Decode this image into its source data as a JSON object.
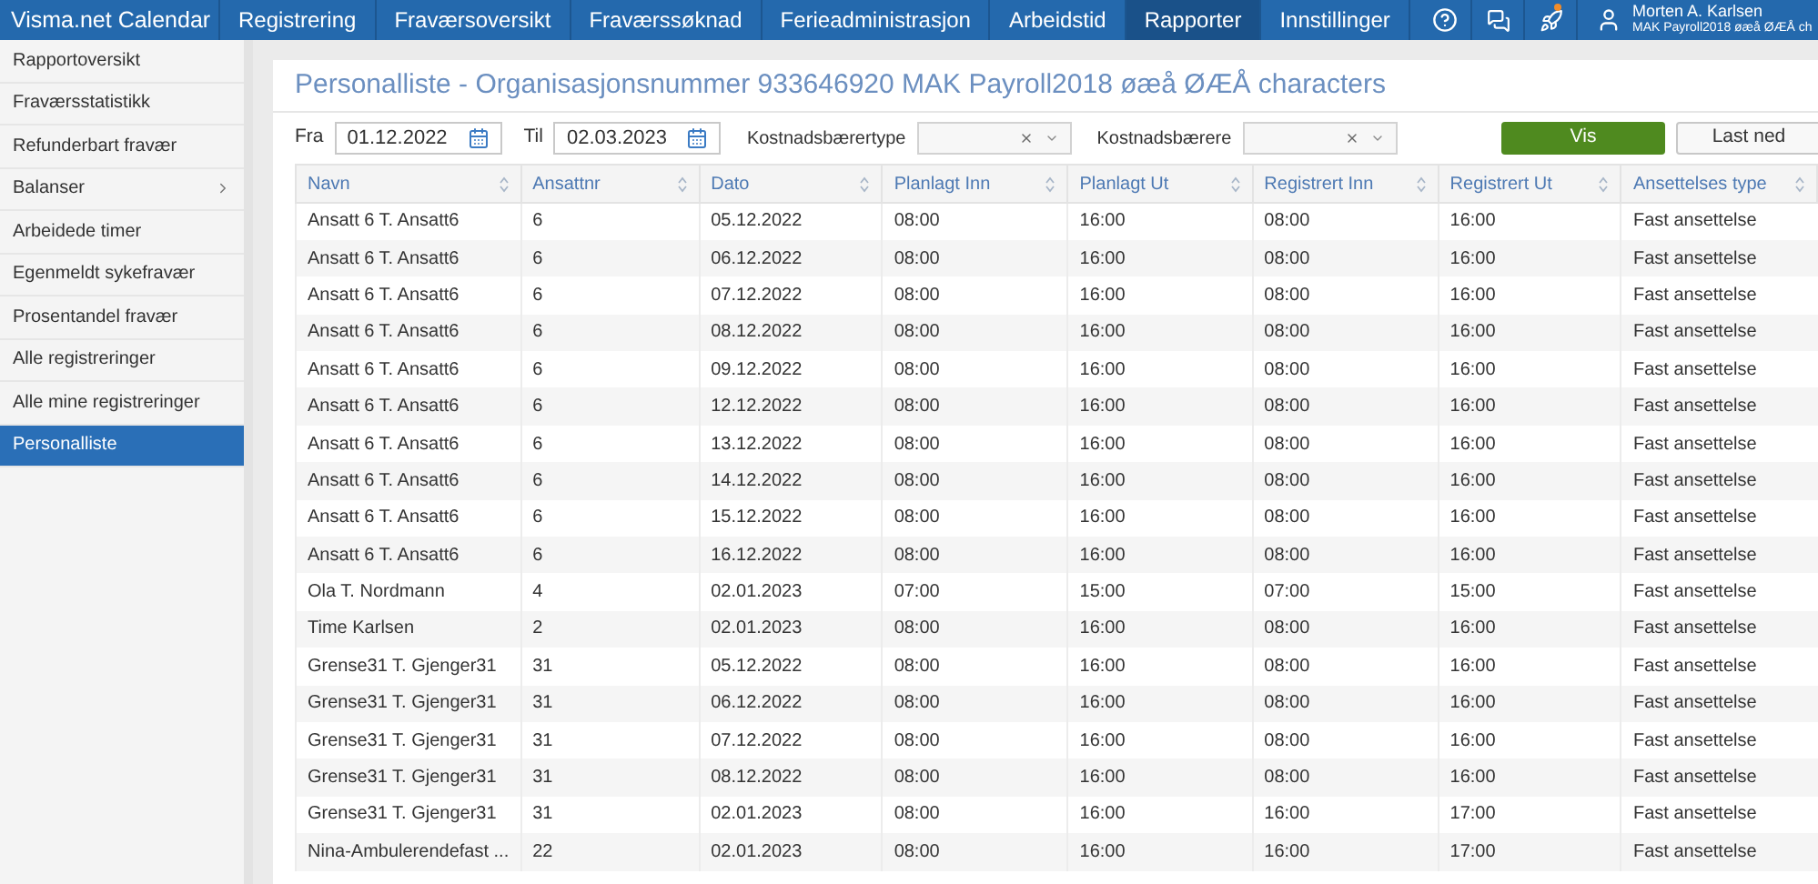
{
  "app": {
    "title": "Visma.net Calendar"
  },
  "nav": [
    {
      "label": "Registrering",
      "selected": false
    },
    {
      "label": "Fraværsoversikt",
      "selected": false
    },
    {
      "label": "Fraværssøknad",
      "selected": false
    },
    {
      "label": "Ferieadministrasjon",
      "selected": false
    },
    {
      "label": "Arbeidstid",
      "selected": false
    },
    {
      "label": "Rapporter",
      "selected": true
    },
    {
      "label": "Innstillinger",
      "selected": false
    }
  ],
  "notifications": {
    "unread": true
  },
  "user": {
    "name": "Morten A. Karlsen",
    "company": "MAK Payroll2018 øæå ØÆÅ ch"
  },
  "sidebar": {
    "items": [
      {
        "label": "Rapportoversikt",
        "selected": false,
        "expandable": false
      },
      {
        "label": "Fraværsstatistikk",
        "selected": false,
        "expandable": false
      },
      {
        "label": "Refunderbart fravær",
        "selected": false,
        "expandable": false
      },
      {
        "label": "Balanser",
        "selected": false,
        "expandable": true
      },
      {
        "label": "Arbeidede timer",
        "selected": false,
        "expandable": false
      },
      {
        "label": "Egenmeldt sykefravær",
        "selected": false,
        "expandable": false
      },
      {
        "label": "Prosentandel fravær",
        "selected": false,
        "expandable": false
      },
      {
        "label": "Alle registreringer",
        "selected": false,
        "expandable": false
      },
      {
        "label": "Alle mine registreringer",
        "selected": false,
        "expandable": false
      },
      {
        "label": "Personalliste",
        "selected": true,
        "expandable": false
      }
    ]
  },
  "page": {
    "title": "Personalliste - Organisasjonsnummer 933646920 MAK Payroll2018 øæå ØÆÅ characters"
  },
  "filters": {
    "from_label": "Fra",
    "from": "01.12.2022",
    "to_label": "Til",
    "to": "02.03.2023",
    "cost_type_label": "Kostnadsbærertype",
    "cost_label": "Kostnadsbærere",
    "show_button": "Vis",
    "download_button": "Last ned"
  },
  "table": {
    "columns": [
      "Navn",
      "Ansattnr",
      "Dato",
      "Planlagt Inn",
      "Planlagt Ut",
      "Registrert Inn",
      "Registrert Ut",
      "Ansettelses type"
    ],
    "rows": [
      [
        "Ansatt 6 T. Ansatt6",
        "6",
        "05.12.2022",
        "08:00",
        "16:00",
        "08:00",
        "16:00",
        "Fast ansettelse"
      ],
      [
        "Ansatt 6 T. Ansatt6",
        "6",
        "06.12.2022",
        "08:00",
        "16:00",
        "08:00",
        "16:00",
        "Fast ansettelse"
      ],
      [
        "Ansatt 6 T. Ansatt6",
        "6",
        "07.12.2022",
        "08:00",
        "16:00",
        "08:00",
        "16:00",
        "Fast ansettelse"
      ],
      [
        "Ansatt 6 T. Ansatt6",
        "6",
        "08.12.2022",
        "08:00",
        "16:00",
        "08:00",
        "16:00",
        "Fast ansettelse"
      ],
      [
        "Ansatt 6 T. Ansatt6",
        "6",
        "09.12.2022",
        "08:00",
        "16:00",
        "08:00",
        "16:00",
        "Fast ansettelse"
      ],
      [
        "Ansatt 6 T. Ansatt6",
        "6",
        "12.12.2022",
        "08:00",
        "16:00",
        "08:00",
        "16:00",
        "Fast ansettelse"
      ],
      [
        "Ansatt 6 T. Ansatt6",
        "6",
        "13.12.2022",
        "08:00",
        "16:00",
        "08:00",
        "16:00",
        "Fast ansettelse"
      ],
      [
        "Ansatt 6 T. Ansatt6",
        "6",
        "14.12.2022",
        "08:00",
        "16:00",
        "08:00",
        "16:00",
        "Fast ansettelse"
      ],
      [
        "Ansatt 6 T. Ansatt6",
        "6",
        "15.12.2022",
        "08:00",
        "16:00",
        "08:00",
        "16:00",
        "Fast ansettelse"
      ],
      [
        "Ansatt 6 T. Ansatt6",
        "6",
        "16.12.2022",
        "08:00",
        "16:00",
        "08:00",
        "16:00",
        "Fast ansettelse"
      ],
      [
        "Ola T. Nordmann",
        "4",
        "02.01.2023",
        "07:00",
        "15:00",
        "07:00",
        "15:00",
        "Fast ansettelse"
      ],
      [
        "Time Karlsen",
        "2",
        "02.01.2023",
        "08:00",
        "16:00",
        "08:00",
        "16:00",
        "Fast ansettelse"
      ],
      [
        "Grense31 T. Gjenger31",
        "31",
        "05.12.2022",
        "08:00",
        "16:00",
        "08:00",
        "16:00",
        "Fast ansettelse"
      ],
      [
        "Grense31 T. Gjenger31",
        "31",
        "06.12.2022",
        "08:00",
        "16:00",
        "08:00",
        "16:00",
        "Fast ansettelse"
      ],
      [
        "Grense31 T. Gjenger31",
        "31",
        "07.12.2022",
        "08:00",
        "16:00",
        "08:00",
        "16:00",
        "Fast ansettelse"
      ],
      [
        "Grense31 T. Gjenger31",
        "31",
        "08.12.2022",
        "08:00",
        "16:00",
        "08:00",
        "16:00",
        "Fast ansettelse"
      ],
      [
        "Grense31 T. Gjenger31",
        "31",
        "02.01.2023",
        "08:00",
        "16:00",
        "16:00",
        "17:00",
        "Fast ansettelse"
      ],
      [
        "Nina-Ambulerendefast ...",
        "22",
        "02.01.2023",
        "08:00",
        "16:00",
        "16:00",
        "17:00",
        "Fast ansettelse"
      ]
    ]
  }
}
